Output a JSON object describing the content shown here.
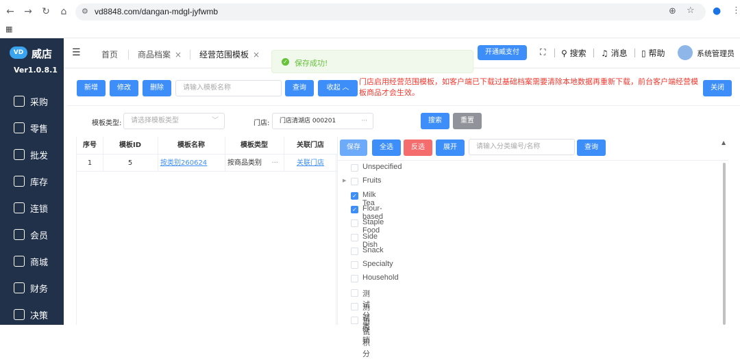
{
  "browser": {
    "url": "vd8848.com/dangan-mdgl-jyfwmb"
  },
  "sidebar": {
    "logo_mark": "VD",
    "logo_name": "威店",
    "version": "Ver1.0.8.1",
    "items": [
      {
        "label": "采购"
      },
      {
        "label": "零售"
      },
      {
        "label": "批发"
      },
      {
        "label": "库存"
      },
      {
        "label": "连锁"
      },
      {
        "label": "会员"
      },
      {
        "label": "商城"
      },
      {
        "label": "财务"
      },
      {
        "label": "决策"
      }
    ]
  },
  "header": {
    "tabs": [
      {
        "label": "首页"
      },
      {
        "label": "商品档案"
      },
      {
        "label": "经营范围模板"
      }
    ],
    "pay_button": "开通威支付",
    "search": "搜索",
    "messages": "消息",
    "help": "帮助",
    "user": "系统管理员"
  },
  "toast": {
    "text": "保存成功!"
  },
  "toolbar": {
    "add": "新增",
    "edit": "修改",
    "delete": "删除",
    "name_placeholder": "请输入模板名称",
    "query": "查询",
    "collapse": "收起",
    "notice": "门店启用经营范围模板，如客户端已下载过基础档案需要清除本地数据再重新下载，前台客户端经营模板商品才会生效。",
    "close": "关闭"
  },
  "filter": {
    "type_label": "模板类型:",
    "type_placeholder": "请选择模板类型",
    "store_label": "门店:",
    "store_value": "门店清湖店 000201",
    "search": "搜索",
    "reset": "重置"
  },
  "table": {
    "headers": [
      "序号",
      "模板ID",
      "模板名称",
      "模板类型",
      "关联门店"
    ],
    "rows": [
      {
        "index": "1",
        "id": "5",
        "name": "按类别260624",
        "type": "按商品类别",
        "store": "关联门店"
      }
    ]
  },
  "tree_toolbar": {
    "save": "保存",
    "select_all": "全选",
    "invert": "反选",
    "expand": "展开",
    "placeholder": "请输入分类编号/名称",
    "query": "查询"
  },
  "categories": [
    {
      "label": "Unspecified",
      "checked": false
    },
    {
      "label": "Fruits",
      "checked": false
    },
    {
      "label": "Milk Tea",
      "checked": true
    },
    {
      "label": "Flour-based",
      "checked": true
    },
    {
      "label": "Staple Food",
      "checked": false
    },
    {
      "label": "Side Dish",
      "checked": false
    },
    {
      "label": "Snack",
      "checked": false
    },
    {
      "label": "Specialty",
      "checked": false
    },
    {
      "label": "Household",
      "checked": false
    },
    {
      "label": "测试分类",
      "checked": false
    },
    {
      "label": "测试促销",
      "checked": false
    },
    {
      "label": "测试积分",
      "checked": false
    }
  ],
  "colors": {
    "primary": "#3d8ef8",
    "danger": "#f56c6c",
    "sidebar": "#21314a",
    "notice": "#f03a30",
    "success": "#67c23a"
  }
}
